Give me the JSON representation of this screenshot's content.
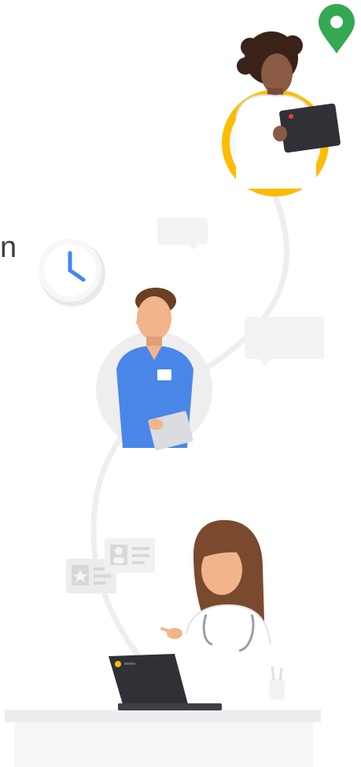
{
  "text": {
    "partial_word": "n"
  },
  "icons": {
    "map_pin": "map-pin-icon",
    "clock": "clock-icon",
    "chrome": "chrome-logo-icon"
  },
  "colors": {
    "pin_green": "#34A853",
    "ring_yellow": "#FBBC04",
    "clock_blue": "#4285F4",
    "scrub_blue": "#4A86E8",
    "path_gray": "#EEEEEE",
    "bubble_gray": "#F1F3F4",
    "laptop_dark": "#2F3136",
    "desk_gray": "#EDEEF0"
  }
}
